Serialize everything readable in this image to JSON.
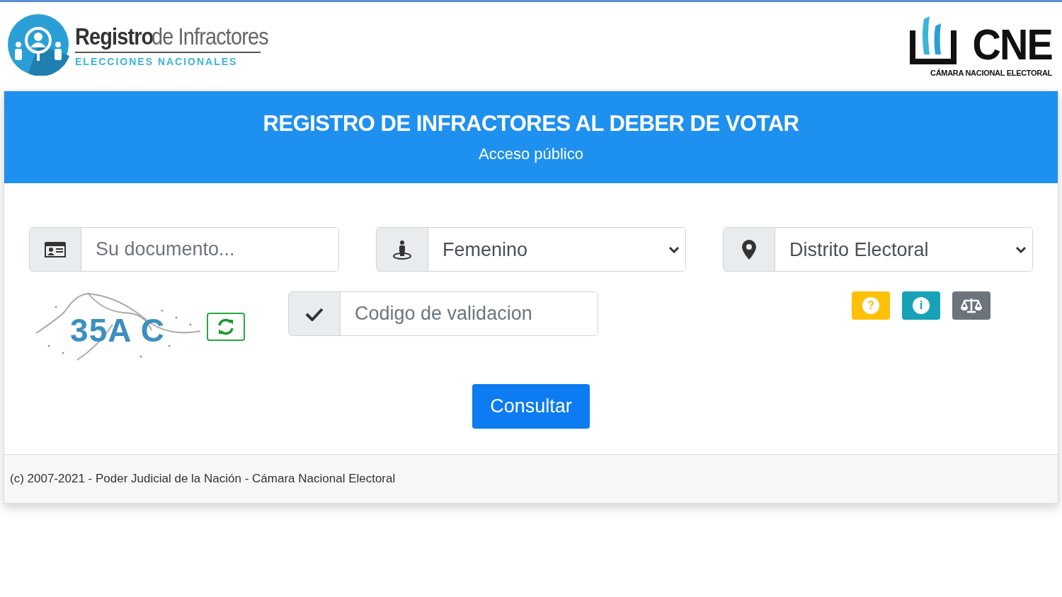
{
  "header": {
    "logo_title_bold": "Registro",
    "logo_title_light": "de Infractores",
    "logo_subtitle": "ELECCIONES NACIONALES",
    "cne_name": "CNE",
    "cne_subtitle": "CÁMARA NACIONAL ELECTORAL"
  },
  "banner": {
    "title": "REGISTRO DE INFRACTORES AL DEBER DE VOTAR",
    "subtitle": "Acceso público"
  },
  "form": {
    "document": {
      "placeholder": "Su documento..."
    },
    "gender": {
      "value": "Femenino"
    },
    "district": {
      "value": "Distrito Electoral"
    },
    "captcha": {
      "text": "35A C"
    },
    "validation": {
      "placeholder": "Codigo de validacion"
    },
    "info_buttons": [
      {
        "kind": "help",
        "label": "?"
      },
      {
        "kind": "info",
        "label": "i"
      },
      {
        "kind": "legal"
      }
    ],
    "submit": "Consultar"
  },
  "footer": "(c) 2007-2021 - Poder Judicial de la Nación - Cámara Nacional Electoral"
}
